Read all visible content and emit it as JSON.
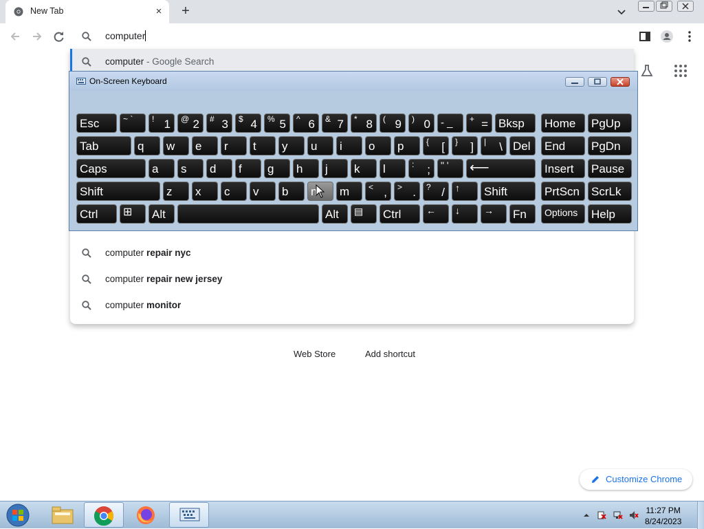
{
  "browser": {
    "tab_title": "New Tab",
    "close_glyph": "×",
    "new_tab_glyph": "+",
    "omnibox_value": "computer"
  },
  "suggestions": [
    {
      "prefix": "computer",
      "bold": "",
      "suffix": " - Google Search"
    },
    {
      "prefix": "computer",
      "bold": " repair nyc",
      "suffix": ""
    },
    {
      "prefix": "computer",
      "bold": " repair new jersey",
      "suffix": ""
    },
    {
      "prefix": "computer",
      "bold": " monitor",
      "suffix": ""
    }
  ],
  "ntp": {
    "shortcut_1": "Web Store",
    "shortcut_2": "Add shortcut",
    "customize_label": "Customize Chrome"
  },
  "osk": {
    "title": "On-Screen Keyboard",
    "keys": {
      "esc": "Esc",
      "tilde_top": "~ `",
      "n1_top": "!",
      "n1": "1",
      "n2_top": "@",
      "n2": "2",
      "n3_top": "#",
      "n3": "3",
      "n4_top": "$",
      "n4": "4",
      "n5_top": "%",
      "n5": "5",
      "n6_top": "^",
      "n6": "6",
      "n7_top": "&",
      "n7": "7",
      "n8_top": "*",
      "n8": "8",
      "n9_top": "(",
      "n9": "9",
      "n0_top": ")",
      "n0": "0",
      "minus_top": "- _",
      "plus_top": "+",
      "equals": "=",
      "bksp": "Bksp",
      "home": "Home",
      "pgup": "PgUp",
      "tab": "Tab",
      "q": "q",
      "w": "w",
      "e": "e",
      "r": "r",
      "t": "t",
      "y": "y",
      "u": "u",
      "i": "i",
      "o": "o",
      "p": "p",
      "lbr_top": "{",
      "lbr": "[",
      "rbr_top": "}",
      "rbr": "]",
      "pipe_top": "|",
      "bslash": "\\",
      "del": "Del",
      "end": "End",
      "pgdn": "PgDn",
      "caps": "Caps",
      "a": "a",
      "s": "s",
      "d": "d",
      "f": "f",
      "g": "g",
      "h": "h",
      "j": "j",
      "k": "k",
      "l": "l",
      "colon_top": ":",
      "semi": ";",
      "quote_top": "\" '",
      "enter": "⟵",
      "insert": "Insert",
      "pause": "Pause",
      "shift": "Shift",
      "z": "z",
      "x": "x",
      "c": "c",
      "v": "v",
      "b": "b",
      "n": "n",
      "m": "m",
      "lt_top": "<",
      "comma": ",",
      "gt_top": ">",
      "period": ".",
      "q_top": "?",
      "slash": "/",
      "up": "↑",
      "prtscn": "PrtScn",
      "scrlk": "ScrLk",
      "ctrl": "Ctrl",
      "win": "⊞",
      "alt": "Alt",
      "menu": "▤",
      "left": "←",
      "down": "↓",
      "right": "→",
      "fn": "Fn",
      "options": "Options",
      "help": "Help"
    }
  },
  "taskbar": {
    "time": "11:27 PM",
    "date": "8/24/2023"
  }
}
